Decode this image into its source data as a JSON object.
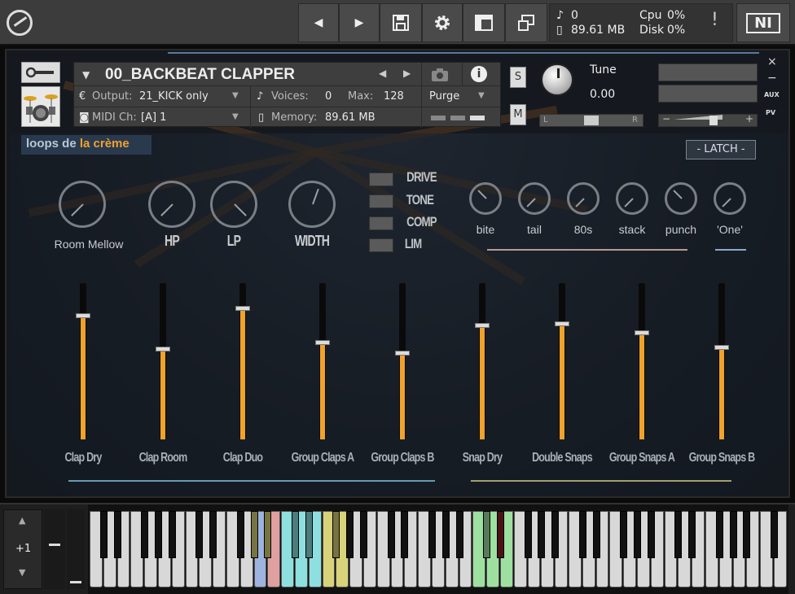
{
  "topbar": {
    "nav_prev": "◀",
    "nav_next": "▶",
    "voices_count": "0",
    "memory_total": "89.61 MB",
    "cpu_label": "Cpu",
    "cpu_value": "0%",
    "disk_label": "Disk",
    "disk_value": "0%",
    "alert": "!",
    "ni_logo": "NI"
  },
  "instrument": {
    "name": "00_BACKBEAT CLAPPER",
    "output_label": "Output:",
    "output_value": "21_KICK only",
    "voices_label": "Voices:",
    "voices_value": "0",
    "max_label": "Max:",
    "max_value": "128",
    "midi_label": "MIDI Ch:",
    "midi_value": "[A]  1",
    "memory_label": "Memory:",
    "memory_value": "89.61 MB",
    "purge_label": "Purge",
    "solo_label": "S",
    "mute_label": "M",
    "tune_label": "Tune",
    "tune_value": "0.00",
    "pan_left": "L",
    "pan_right": "R",
    "vol_minus": "−",
    "vol_plus": "+",
    "close": "×",
    "minimize": "−",
    "aux": "AUX",
    "pv": "PV"
  },
  "brand": {
    "part1": "loops de ",
    "part2": "la crème"
  },
  "latch_label": "- LATCH -",
  "knobs_left": [
    {
      "label": "Room Mellow"
    },
    {
      "label": "HP"
    },
    {
      "label": "LP"
    },
    {
      "label": "WIDTH"
    }
  ],
  "switches": [
    "DRIVE",
    "TONE",
    "COMP",
    "LIM"
  ],
  "knobs_right": [
    {
      "label": "bite"
    },
    {
      "label": "tail"
    },
    {
      "label": "80s"
    },
    {
      "label": "stack"
    },
    {
      "label": "punch"
    },
    {
      "label": "'One'"
    }
  ],
  "faders": [
    {
      "label": "Clap Dry",
      "level": 0.79
    },
    {
      "label": "Clap Room",
      "level": 0.58
    },
    {
      "label": "Clap Duo",
      "level": 0.84
    },
    {
      "label": "Group Claps A",
      "level": 0.62
    },
    {
      "label": "Group Claps B",
      "level": 0.55
    },
    {
      "label": "Snap Dry",
      "level": 0.73
    },
    {
      "label": "Double Snaps",
      "level": 0.74
    },
    {
      "label": "Group Snaps A",
      "level": 0.68
    },
    {
      "label": "Group Snaps B",
      "level": 0.59
    }
  ],
  "keyboard": {
    "octave_up": "▲",
    "octave_value": "+1",
    "octave_down": "▼",
    "minus": "−",
    "colors": {
      "yellow": "#d8d27a",
      "blue": "#9fb3e0",
      "red": "#e0a0a0",
      "cyan": "#8ee0e0",
      "green": "#9ee0a0",
      "darkred": "#8a2020"
    }
  }
}
